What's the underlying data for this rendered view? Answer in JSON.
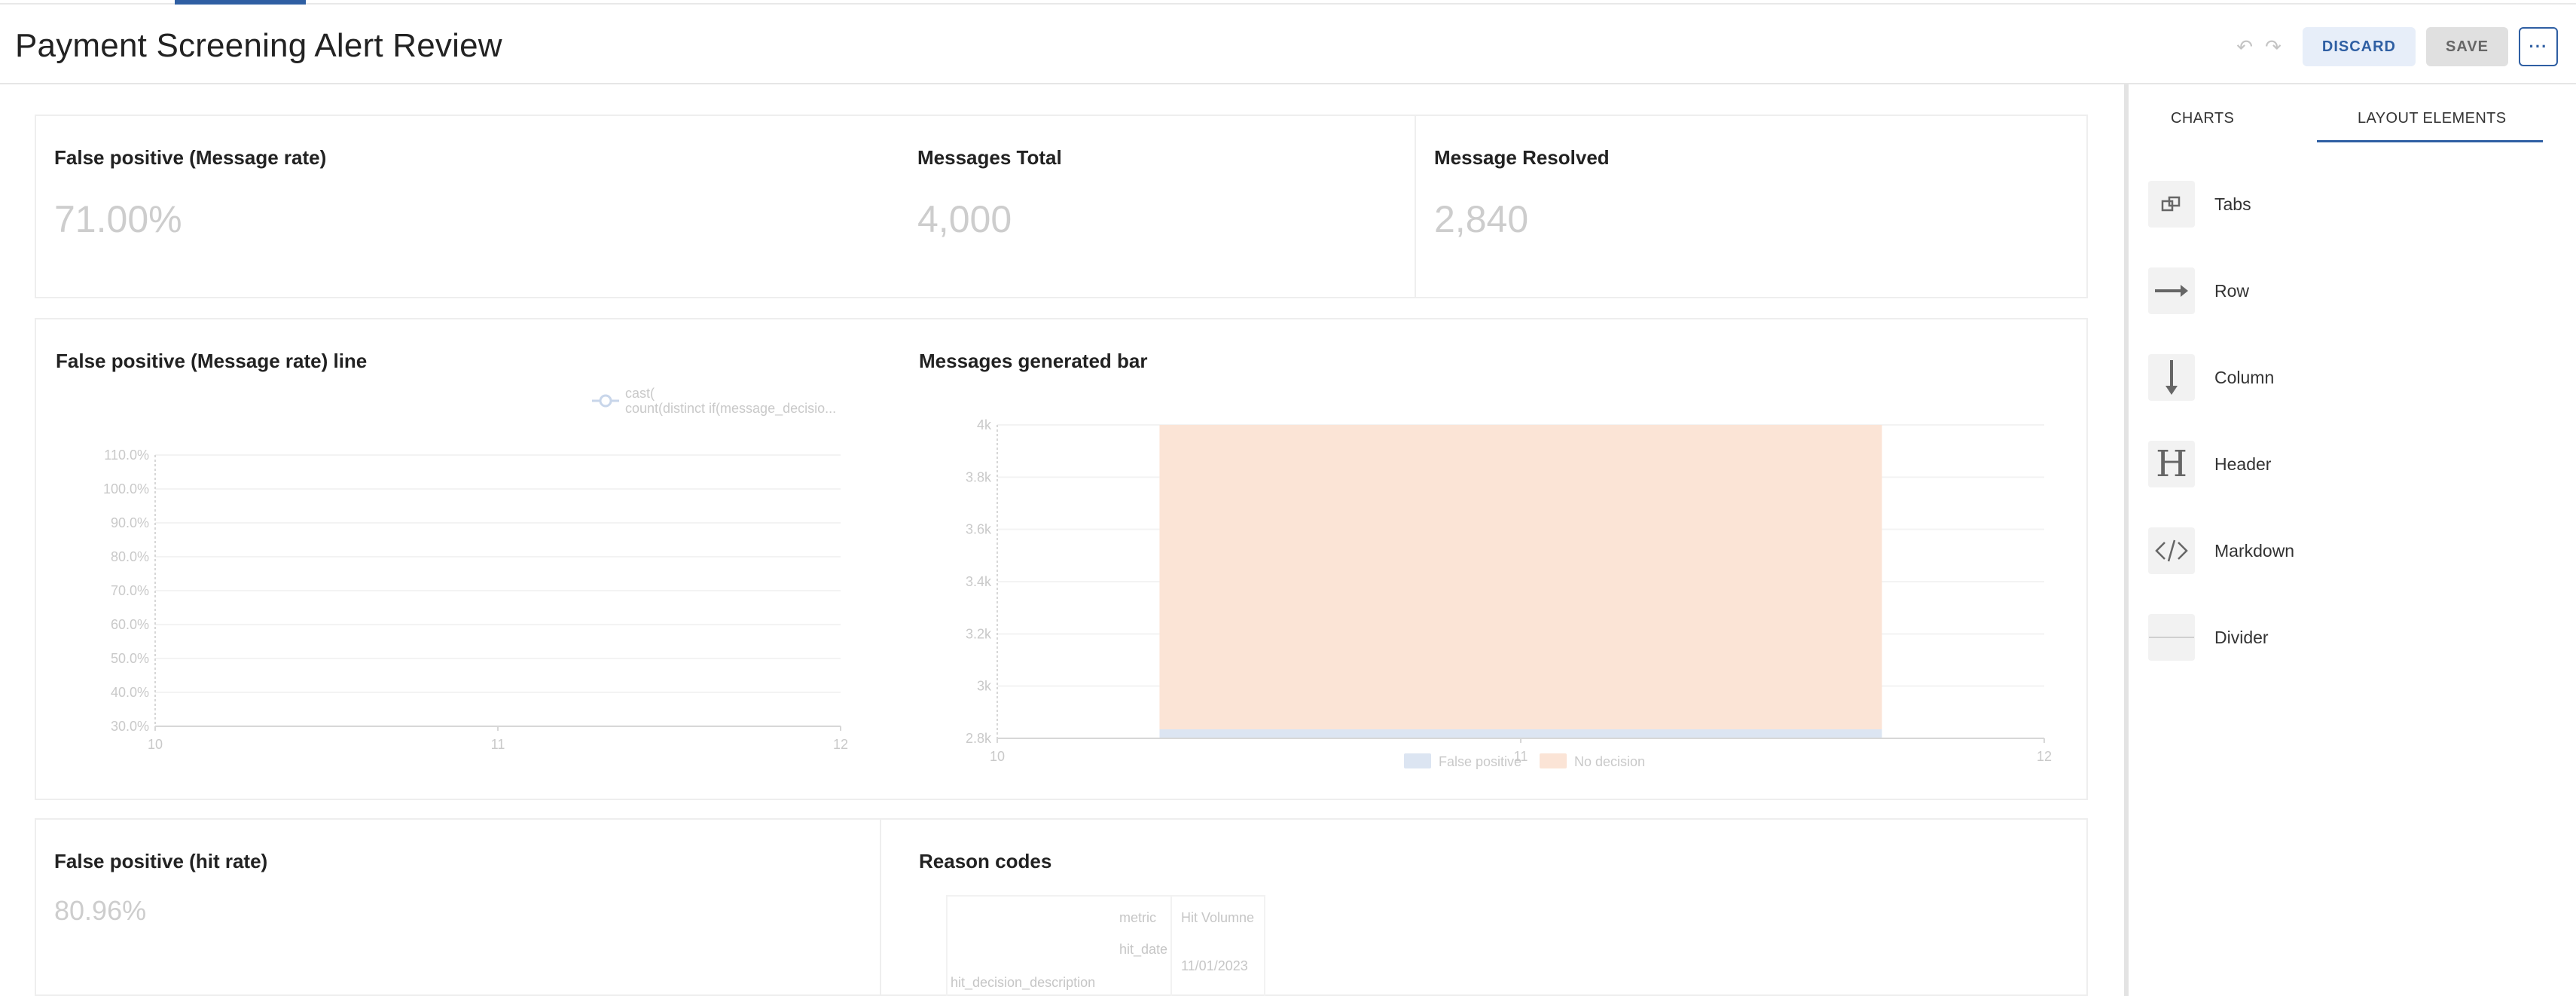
{
  "header": {
    "title": "Payment Screening Alert Review",
    "discard_label": "DISCARD",
    "save_label": "SAVE",
    "more_label": "···"
  },
  "kpis": [
    {
      "title": "False positive (Message rate)",
      "value": "71.00%"
    },
    {
      "title": "Messages Total",
      "value": "4,000"
    },
    {
      "title": "Message Resolved",
      "value": "2,840"
    }
  ],
  "line_chart": {
    "title": "False positive (Message rate) line",
    "legend_line1": "cast(",
    "legend_line2": "count(distinct if(message_decisio..."
  },
  "bar_chart": {
    "title": "Messages generated bar",
    "legend": [
      "False positive",
      "No decision"
    ]
  },
  "hit_rate": {
    "title": "False positive (hit rate)",
    "value": "80.96%"
  },
  "reason_codes": {
    "title": "Reason codes",
    "col_metric": "metric",
    "col_hit_volume": "Hit Volumne",
    "row_hit_date": "hit_date",
    "date_value": "11/01/2023",
    "row_desc": "hit_decision_description"
  },
  "right_panel": {
    "tabs": [
      "CHARTS",
      "LAYOUT ELEMENTS"
    ],
    "active_tab": "LAYOUT ELEMENTS",
    "items": [
      {
        "label": "Tabs",
        "icon": "tabs-icon"
      },
      {
        "label": "Row",
        "icon": "row-arrow-icon"
      },
      {
        "label": "Column",
        "icon": "column-arrow-icon"
      },
      {
        "label": "Header",
        "icon": "header-icon"
      },
      {
        "label": "Markdown",
        "icon": "code-icon"
      },
      {
        "label": "Divider",
        "icon": "divider-icon"
      }
    ]
  },
  "colors": {
    "accent": "#2f5fa3",
    "false_positive": "#dce5f2",
    "no_decision": "#fbe4d6"
  },
  "chart_data": [
    {
      "type": "line",
      "title": "False positive (Message rate) line",
      "x_ticks": [
        "10",
        "11",
        "12"
      ],
      "y_ticks": [
        "30.0%",
        "40.0%",
        "50.0%",
        "60.0%",
        "70.0%",
        "80.0%",
        "90.0%",
        "100.0%",
        "110.0%"
      ],
      "ylim": [
        30,
        110
      ],
      "series": [
        {
          "name": "cast( count(distinct if(message_decisio...",
          "values": []
        }
      ],
      "legend": "top-right",
      "grid": true
    },
    {
      "type": "bar",
      "title": "Messages generated bar",
      "stacked": true,
      "x_ticks": [
        "10",
        "11",
        "12"
      ],
      "y_ticks": [
        "2.8k",
        "3k",
        "3.2k",
        "3.4k",
        "3.6k",
        "3.8k",
        "4k"
      ],
      "ylim": [
        2800,
        4000
      ],
      "categories": [
        "11"
      ],
      "series": [
        {
          "name": "False positive",
          "values": [
            2840
          ]
        },
        {
          "name": "No decision",
          "values": [
            1160
          ]
        }
      ],
      "legend": "bottom",
      "grid": true
    }
  ]
}
